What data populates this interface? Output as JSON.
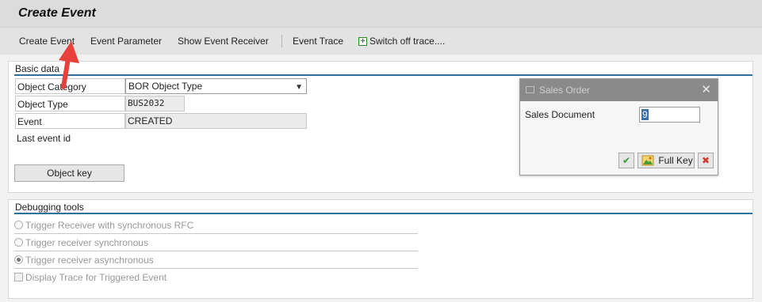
{
  "window": {
    "title": "Create Event"
  },
  "toolbar": {
    "create_event": "Create Event",
    "event_parameter": "Event Parameter",
    "show_event_receiver": "Show Event Receiver",
    "event_trace": "Event Trace",
    "switch_off_trace": "Switch off trace...."
  },
  "basic_data": {
    "section_title": "Basic data",
    "object_category_label": "Object Category",
    "object_category_value": "BOR Object Type",
    "object_type_label": "Object Type",
    "object_type_value": "BUS2032",
    "event_label": "Event",
    "event_value": "CREATED",
    "last_event_id_label": "Last event id",
    "object_key_button": "Object key"
  },
  "debugging": {
    "section_title": "Debugging tools",
    "options": [
      "Trigger Receiver with synchronous RFC",
      "Trigger receiver synchronous",
      "Trigger receiver asynchronous"
    ],
    "selected_option": "Trigger receiver asynchronous",
    "display_trace_label": "Display Trace for Triggered Event"
  },
  "dialog": {
    "title": "Sales Order",
    "field_label": "Sales Document",
    "field_value": "9",
    "full_key_button": "Full Key"
  },
  "colors": {
    "section_rule": "#2f6f9c",
    "annotation_arrow": "#e8403a",
    "confirm_green": "#2e9a2e",
    "cancel_red": "#d03a2a"
  }
}
